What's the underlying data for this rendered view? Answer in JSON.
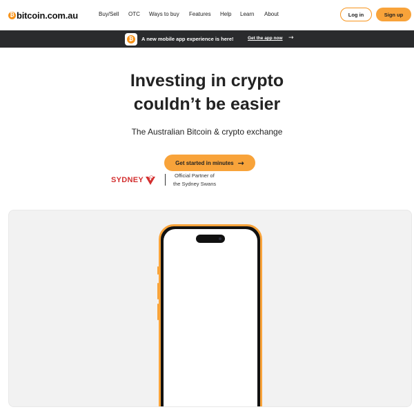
{
  "header": {
    "logo": {
      "coin_glyph": "₿",
      "text": "bitcoin.com.au"
    },
    "nav": [
      "Buy/Sell",
      "OTC",
      "Ways to buy",
      "Features",
      "Help",
      "Learn",
      "About"
    ],
    "login_label": "Log in",
    "signup_label": "Sign up"
  },
  "banner": {
    "coin_glyph": "₿",
    "text": "A new mobile app experience is here!",
    "link": "Get the app now",
    "arrow": "→"
  },
  "hero": {
    "title_line1": "Investing in crypto",
    "title_line2": "couldn’t be easier",
    "subtitle": "The Australian Bitcoin & crypto exchange",
    "cta_label": "Get started in minutes",
    "cta_arrow": "→"
  },
  "partner": {
    "logo_text": "SYDNEY",
    "line1": "Official Partner of",
    "line2": "the Sydney Swans"
  },
  "colors": {
    "accent": "#f8a33a",
    "bitcoin_orange": "#f7931a",
    "banner_bg": "#2a2b2d",
    "swans_red": "#d32f2f",
    "panel_bg": "#f2f2f2"
  },
  "icons": {
    "logo": "bitcoin-coin-icon",
    "banner": "bitcoin-app-icon",
    "banner_arrow": "arrow-right-icon",
    "cta_arrow": "arrow-right-icon",
    "partner": "swan-icon"
  }
}
